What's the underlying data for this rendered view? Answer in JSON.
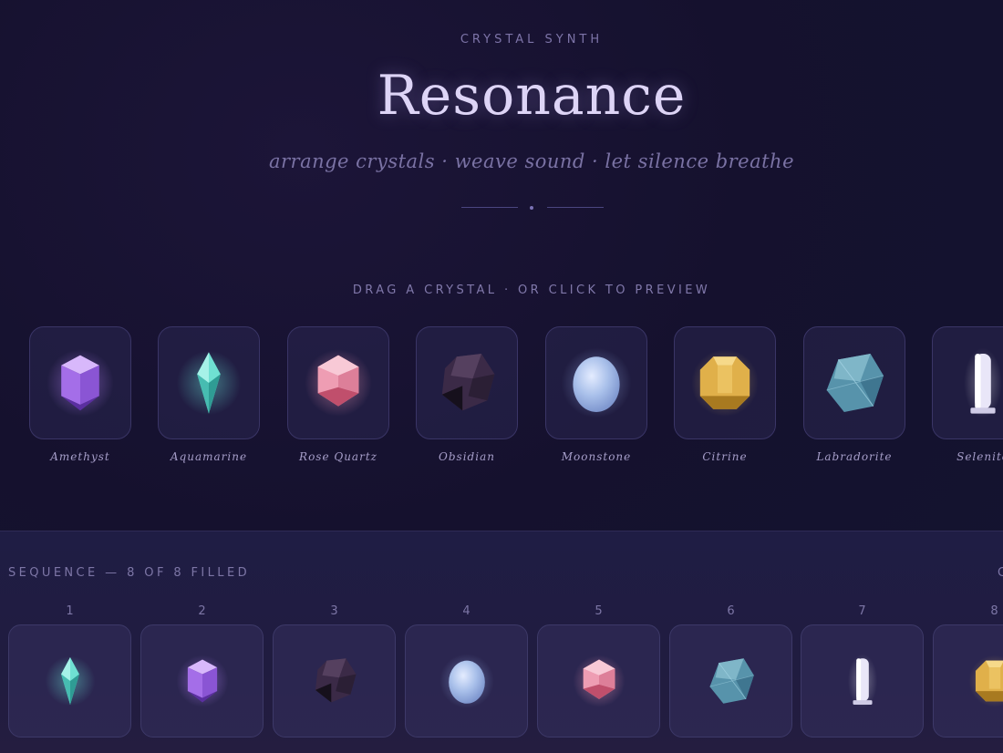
{
  "header": {
    "eyebrow": "CRYSTAL SYNTH",
    "title": "Resonance",
    "tagline": "arrange crystals · weave sound · let silence breathe"
  },
  "palette": {
    "hint": "DRAG A CRYSTAL · OR CLICK TO PREVIEW",
    "crystals": [
      {
        "name": "Amethyst",
        "icon": "amethyst-crystal-icon",
        "color": "#a06be0"
      },
      {
        "name": "Aquamarine",
        "icon": "aquamarine-crystal-icon",
        "color": "#5cd3c6"
      },
      {
        "name": "Rose Quartz",
        "icon": "rose-quartz-crystal-icon",
        "color": "#e68ca6"
      },
      {
        "name": "Obsidian",
        "icon": "obsidian-crystal-icon",
        "color": "#3a2744"
      },
      {
        "name": "Moonstone",
        "icon": "moonstone-crystal-icon",
        "color": "#9fb8e6"
      },
      {
        "name": "Citrine",
        "icon": "citrine-crystal-icon",
        "color": "#e2b448"
      },
      {
        "name": "Labradorite",
        "icon": "labradorite-crystal-icon",
        "color": "#5e9bb5"
      },
      {
        "name": "Selenite",
        "icon": "selenite-crystal-icon",
        "color": "#d7d3ee"
      }
    ]
  },
  "sequence": {
    "label": "SEQUENCE — 8 OF 8 FILLED",
    "corner_text": "C",
    "slots": [
      {
        "number": "1",
        "crystal": "Aquamarine"
      },
      {
        "number": "2",
        "crystal": "Amethyst"
      },
      {
        "number": "3",
        "crystal": "Obsidian"
      },
      {
        "number": "4",
        "crystal": "Moonstone"
      },
      {
        "number": "5",
        "crystal": "Rose Quartz"
      },
      {
        "number": "6",
        "crystal": "Labradorite"
      },
      {
        "number": "7",
        "crystal": "Selenite"
      },
      {
        "number": "8",
        "crystal": "Citrine"
      }
    ]
  }
}
